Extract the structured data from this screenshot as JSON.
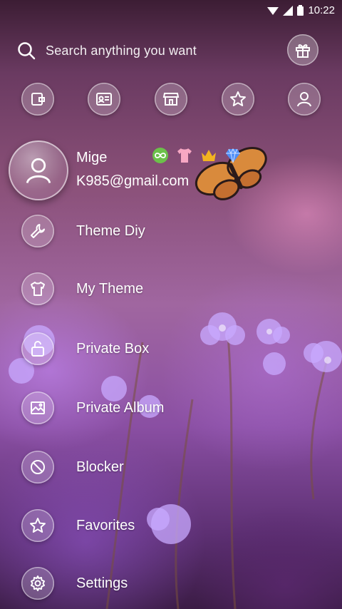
{
  "status_bar": {
    "time": "10:22",
    "icons": [
      "wifi-icon",
      "signal-icon",
      "battery-icon"
    ]
  },
  "search": {
    "placeholder": "Search anything you want",
    "icon": "search-icon"
  },
  "header": {
    "gift_icon": "gift-icon"
  },
  "quick_actions": [
    {
      "icon": "wallet-icon"
    },
    {
      "icon": "contact-card-icon"
    },
    {
      "icon": "store-icon"
    },
    {
      "icon": "star-icon"
    },
    {
      "icon": "person-icon"
    }
  ],
  "profile": {
    "name": "Mige",
    "email": "K985@gmail.com",
    "badges": [
      "infinity-badge-icon",
      "tshirt-badge-icon",
      "crown-badge-icon",
      "diamond-badge-icon"
    ]
  },
  "menu": [
    {
      "label": "Theme Diy",
      "icon": "wrench-icon"
    },
    {
      "label": "My Theme",
      "icon": "tshirt-icon"
    },
    {
      "label": "Private Box",
      "icon": "lock-icon"
    },
    {
      "label": "Private Album",
      "icon": "image-icon"
    },
    {
      "label": "Blocker",
      "icon": "block-icon"
    },
    {
      "label": "Favorites",
      "icon": "star-icon"
    },
    {
      "label": "Settings",
      "icon": "gear-icon"
    }
  ],
  "colors": {
    "accent": "#ffffff",
    "background_top": "#3c1d34",
    "background_mid": "#a066a0",
    "background_bottom": "#3b1c45"
  }
}
